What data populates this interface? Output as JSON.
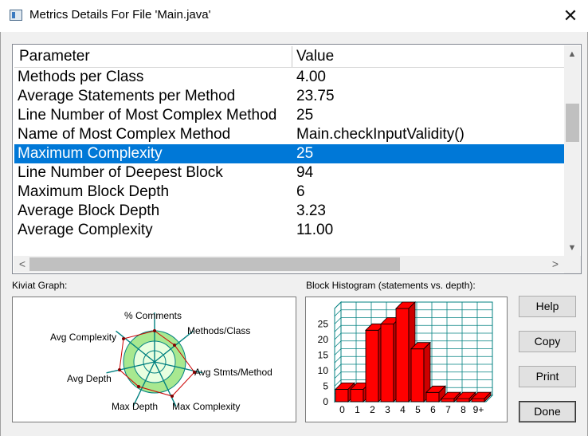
{
  "window": {
    "title": "Metrics Details For File 'Main.java'",
    "close_glyph": "✕"
  },
  "table": {
    "columns": [
      "Parameter",
      "Value"
    ],
    "rows": [
      {
        "param": "Methods per Class",
        "value": "4.00"
      },
      {
        "param": "Average Statements per Method",
        "value": "23.75"
      },
      {
        "param": "Line Number of Most Complex Method",
        "value": "25"
      },
      {
        "param": "Name of Most Complex Method",
        "value": "Main.checkInputValidity()"
      },
      {
        "param": "Maximum Complexity",
        "value": "25"
      },
      {
        "param": "Line Number of Deepest Block",
        "value": "94"
      },
      {
        "param": "Maximum Block Depth",
        "value": "6"
      },
      {
        "param": "Average Block Depth",
        "value": "3.23"
      },
      {
        "param": "Average Complexity",
        "value": "11.00"
      }
    ],
    "selected_row": 4,
    "arrows": {
      "up": "▲",
      "down": "▼",
      "left": "<",
      "right": ">"
    }
  },
  "kiviat": {
    "label": "Kiviat Graph:",
    "axes": [
      "% Comments",
      "Methods/Class",
      "Avg Stmts/Method",
      "Max Complexity",
      "Max Depth",
      "Avg Depth",
      "Avg Complexity"
    ],
    "colors": {
      "outer_ring": "#a8e890",
      "inner_ring": "#e8ffe0",
      "axis": "#008080",
      "polygon": "#cc0000"
    }
  },
  "histogram": {
    "label": "Block Histogram (statements vs. depth):",
    "bar_color": "#ff0000",
    "grid_color": "#008080"
  },
  "chart_data": {
    "type": "bar",
    "categories": [
      "0",
      "1",
      "2",
      "3",
      "4",
      "5",
      "6",
      "7",
      "8",
      "9+"
    ],
    "values": [
      4,
      4,
      23,
      25,
      30,
      17,
      3,
      1,
      1,
      1
    ],
    "title": "Block Histogram (statements vs. depth):",
    "xlabel": "",
    "ylabel": "",
    "yticks": [
      0,
      5,
      10,
      15,
      20,
      25
    ],
    "ylim": [
      0,
      30
    ],
    "grid": true,
    "style": "3d"
  },
  "buttons": {
    "help": "Help",
    "copy": "Copy",
    "print": "Print",
    "done": "Done"
  }
}
